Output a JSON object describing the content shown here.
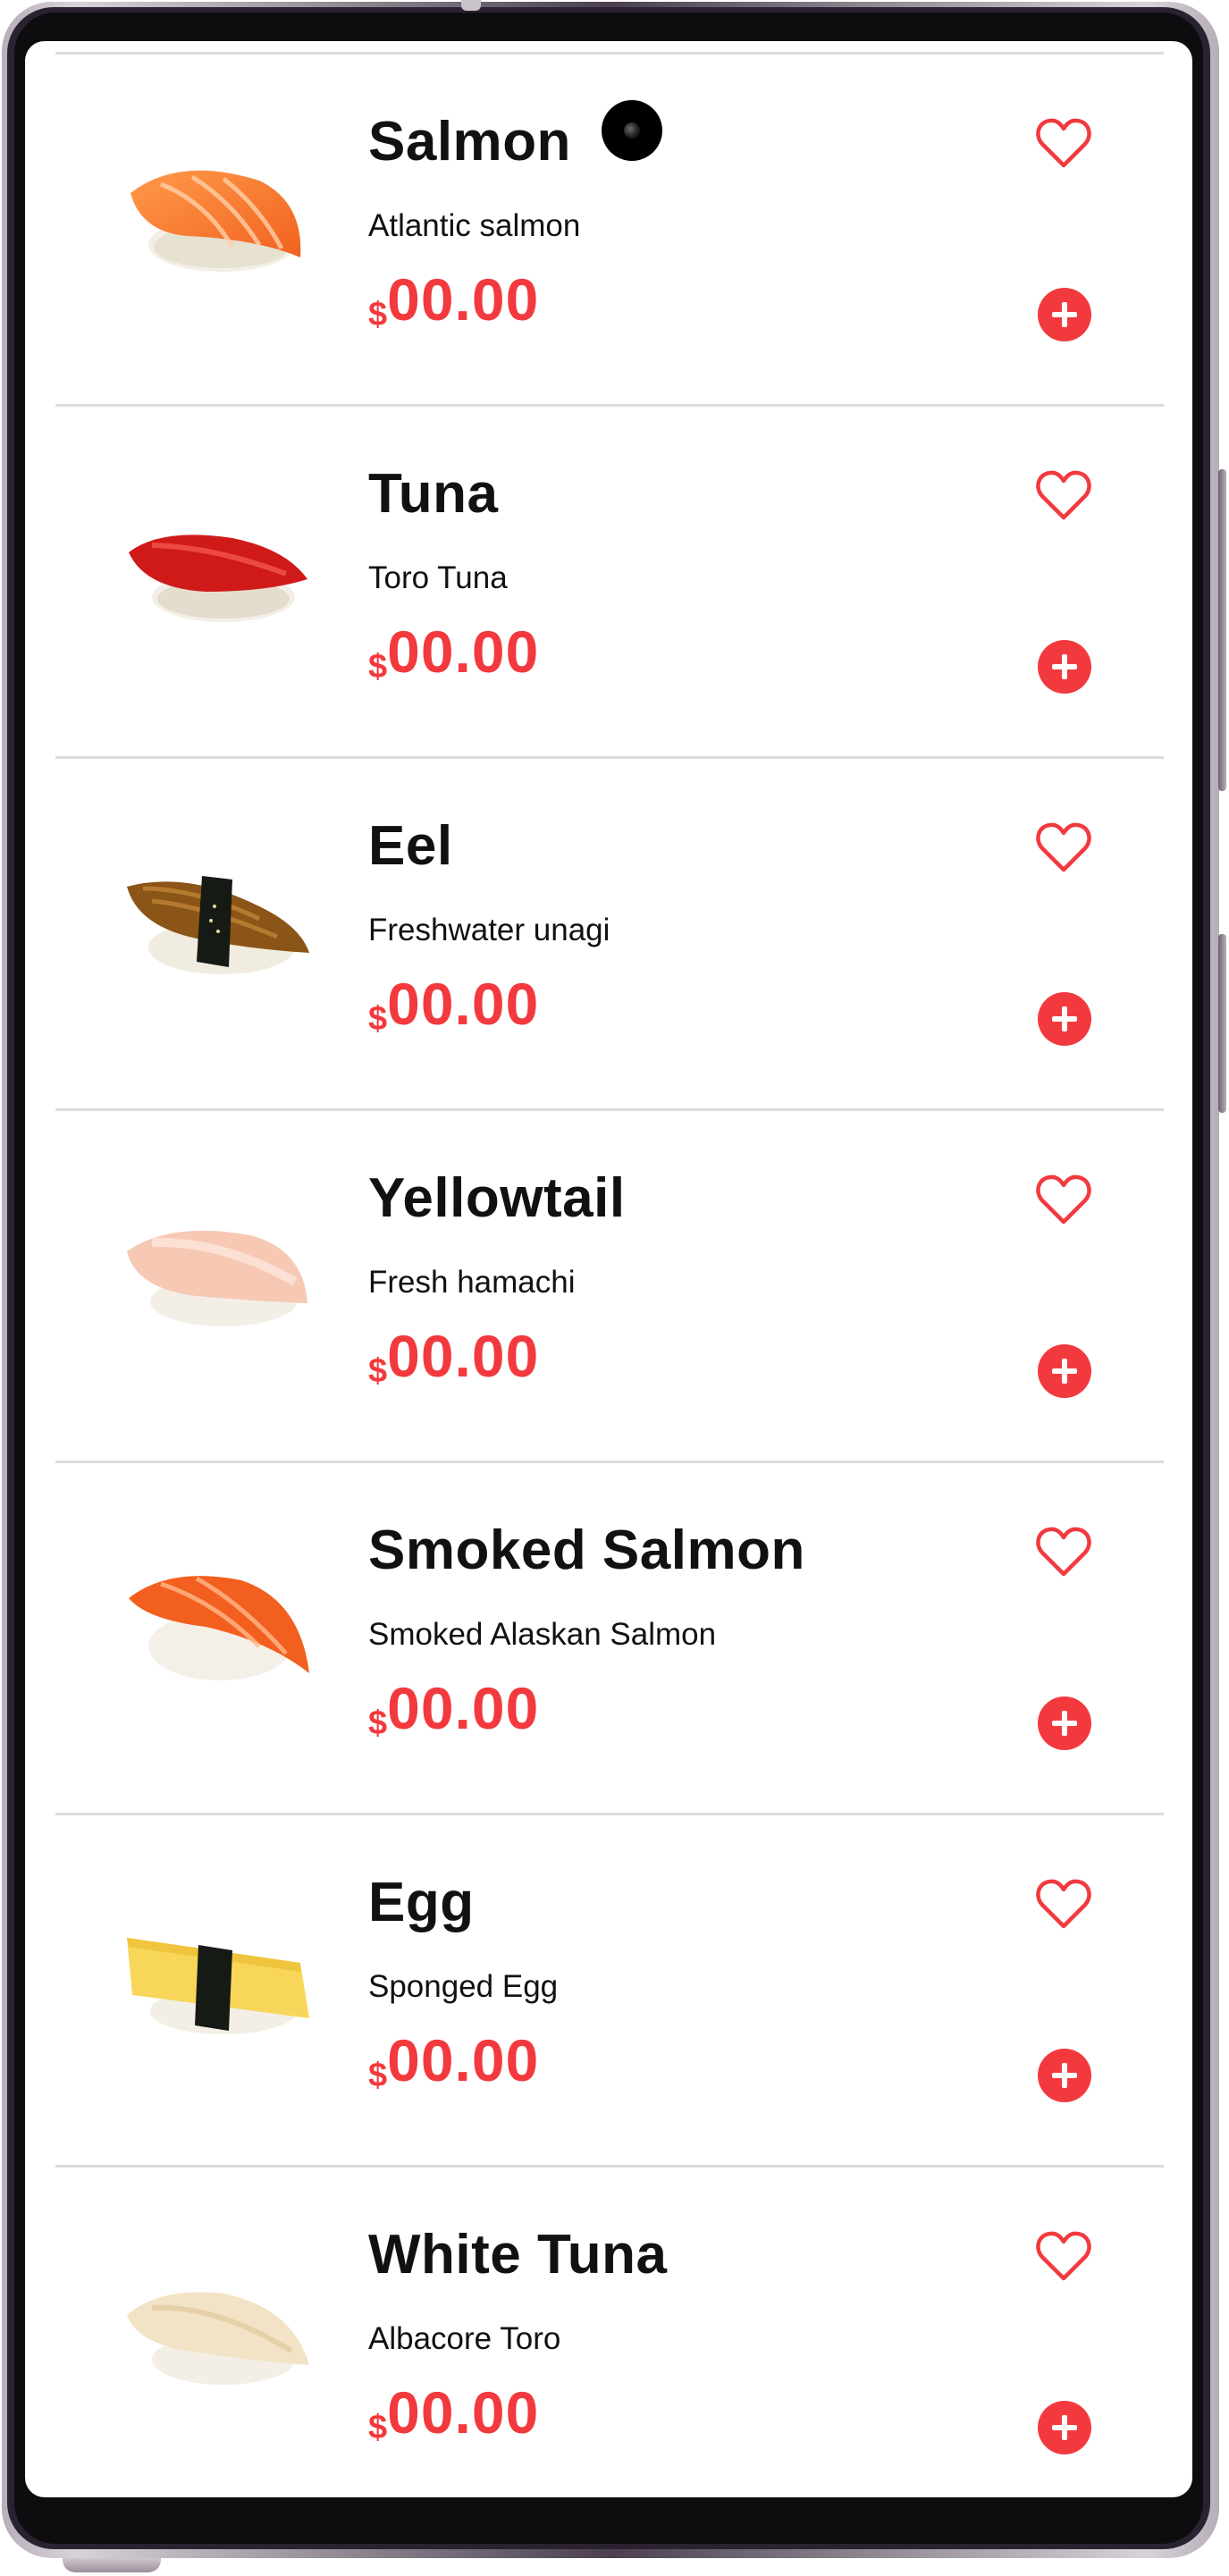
{
  "colors": {
    "accent": "#f23a3e",
    "text": "#111111",
    "divider": "#dcdcdc"
  },
  "menu": {
    "items": [
      {
        "name": "Salmon",
        "description": "Atlantic salmon",
        "currency": "$",
        "price": "00.00",
        "icon": "salmon-nigiri-image",
        "favorite_icon": "heart-outline-icon",
        "add_icon": "plus-circle-icon"
      },
      {
        "name": "Tuna",
        "description": "Toro Tuna",
        "currency": "$",
        "price": "00.00",
        "icon": "tuna-nigiri-image",
        "favorite_icon": "heart-outline-icon",
        "add_icon": "plus-circle-icon"
      },
      {
        "name": "Eel",
        "description": "Freshwater unagi",
        "currency": "$",
        "price": "00.00",
        "icon": "eel-nigiri-image",
        "favorite_icon": "heart-outline-icon",
        "add_icon": "plus-circle-icon"
      },
      {
        "name": "Yellowtail",
        "description": "Fresh hamachi",
        "currency": "$",
        "price": "00.00",
        "icon": "yellowtail-nigiri-image",
        "favorite_icon": "heart-outline-icon",
        "add_icon": "plus-circle-icon"
      },
      {
        "name": "Smoked Salmon",
        "description": "Smoked Alaskan Salmon",
        "currency": "$",
        "price": "00.00",
        "icon": "smoked-salmon-nigiri-image",
        "favorite_icon": "heart-outline-icon",
        "add_icon": "plus-circle-icon"
      },
      {
        "name": "Egg",
        "description": "Sponged Egg",
        "currency": "$",
        "price": "00.00",
        "icon": "egg-nigiri-image",
        "favorite_icon": "heart-outline-icon",
        "add_icon": "plus-circle-icon"
      },
      {
        "name": "White Tuna",
        "description": "Albacore Toro",
        "currency": "$",
        "price": "00.00",
        "icon": "white-tuna-nigiri-image",
        "favorite_icon": "heart-outline-icon",
        "add_icon": "plus-circle-icon"
      }
    ]
  }
}
